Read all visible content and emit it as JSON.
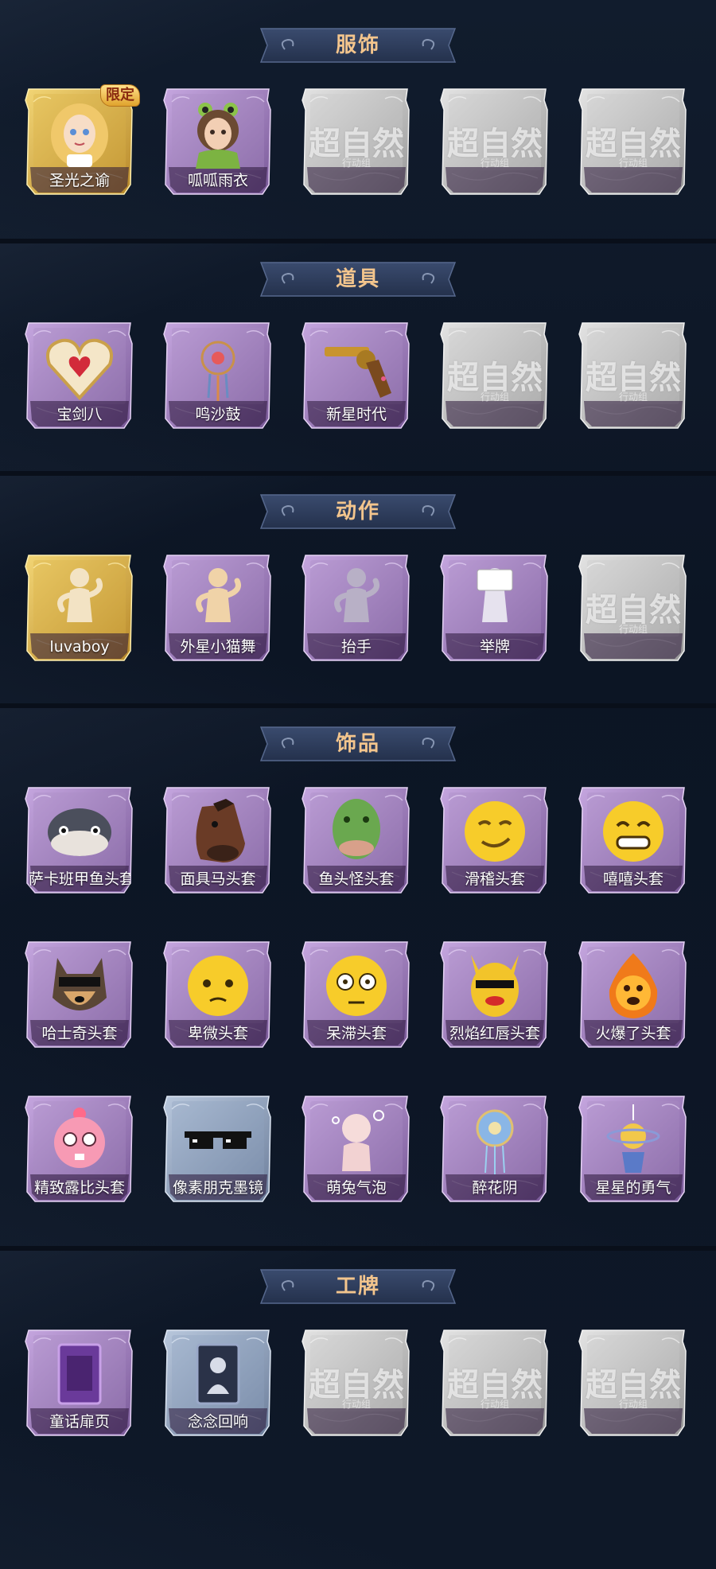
{
  "colors": {
    "background": "#0d1626",
    "banner": "#2b3a58",
    "banner_text": "#f3c58d",
    "purple_frame": "#a98bc2",
    "gold_frame": "#d9b347",
    "silver_frame": "#c9c9c9",
    "blue_frame": "#8fa3bf"
  },
  "sections": [
    {
      "title": "服饰",
      "items": [
        {
          "label": "圣光之谕",
          "tier": "gold",
          "icon": "costume-golden-hair-girl-icon",
          "badge": "限定"
        },
        {
          "label": "呱呱雨衣",
          "tier": "purple",
          "icon": "costume-frog-raincoat-icon"
        },
        {
          "label": "",
          "tier": "locked",
          "icon": "locked-placeholder-icon"
        },
        {
          "label": "",
          "tier": "locked",
          "icon": "locked-placeholder-icon"
        },
        {
          "label": "",
          "tier": "locked",
          "icon": "locked-placeholder-icon"
        }
      ]
    },
    {
      "title": "道具",
      "items": [
        {
          "label": "宝剑八",
          "tier": "purple",
          "icon": "heart-mirror-icon"
        },
        {
          "label": "鸣沙鼓",
          "tier": "purple",
          "icon": "dreamcatcher-icon"
        },
        {
          "label": "新星时代",
          "tier": "purple",
          "icon": "revolver-icon"
        },
        {
          "label": "",
          "tier": "locked",
          "icon": "locked-placeholder-icon"
        },
        {
          "label": "",
          "tier": "locked",
          "icon": "locked-placeholder-icon"
        }
      ]
    },
    {
      "title": "动作",
      "items": [
        {
          "label": "luvaboy",
          "tier": "gold",
          "icon": "pose-figure-icon"
        },
        {
          "label": "外星小猫舞",
          "tier": "purple",
          "icon": "dance-figure-icon"
        },
        {
          "label": "抬手",
          "tier": "purple",
          "icon": "raise-hand-figure-icon"
        },
        {
          "label": "举牌",
          "tier": "purple",
          "icon": "hold-sign-figure-icon"
        },
        {
          "label": "",
          "tier": "locked",
          "icon": "locked-placeholder-icon"
        }
      ]
    },
    {
      "title": "饰品",
      "items": [
        {
          "label": "萨卡班甲鱼头套",
          "tier": "purple",
          "icon": "fish-head-icon"
        },
        {
          "label": "面具马头套",
          "tier": "purple",
          "icon": "horse-mask-icon"
        },
        {
          "label": "鱼头怪头套",
          "tier": "purple",
          "icon": "green-fish-mask-icon"
        },
        {
          "label": "滑稽头套",
          "tier": "purple",
          "icon": "smirk-emoji-icon"
        },
        {
          "label": "嘻嘻头套",
          "tier": "purple",
          "icon": "grin-emoji-icon"
        },
        {
          "label": "哈士奇头套",
          "tier": "purple",
          "icon": "husky-sunglasses-icon"
        },
        {
          "label": "卑微头套",
          "tier": "purple",
          "icon": "pleading-emoji-icon"
        },
        {
          "label": "呆滞头套",
          "tier": "purple",
          "icon": "stunned-emoji-icon"
        },
        {
          "label": "烈焰红唇头套",
          "tier": "purple",
          "icon": "yellow-creature-sunglasses-icon"
        },
        {
          "label": "火爆了头套",
          "tier": "purple",
          "icon": "fire-spirit-icon"
        },
        {
          "label": "精致露比头套",
          "tier": "purple",
          "icon": "pink-beaver-icon"
        },
        {
          "label": "像素朋克墨镜",
          "tier": "blue",
          "icon": "pixel-sunglasses-icon"
        },
        {
          "label": "萌兔气泡",
          "tier": "purple",
          "icon": "bubble-figure-icon"
        },
        {
          "label": "醉花阴",
          "tier": "purple",
          "icon": "floral-ornament-icon"
        },
        {
          "label": "星星的勇气",
          "tier": "purple",
          "icon": "star-charm-icon"
        }
      ]
    },
    {
      "title": "工牌",
      "items": [
        {
          "label": "童话扉页",
          "tier": "purple",
          "icon": "storybook-card-icon"
        },
        {
          "label": "念念回响",
          "tier": "blue",
          "icon": "silhouette-card-icon"
        },
        {
          "label": "",
          "tier": "locked",
          "icon": "locked-placeholder-icon"
        },
        {
          "label": "",
          "tier": "locked",
          "icon": "locked-placeholder-icon"
        },
        {
          "label": "",
          "tier": "locked",
          "icon": "locked-placeholder-icon"
        }
      ]
    }
  ],
  "locked_watermark": {
    "title": "超自然",
    "subtitle": "行动组"
  }
}
